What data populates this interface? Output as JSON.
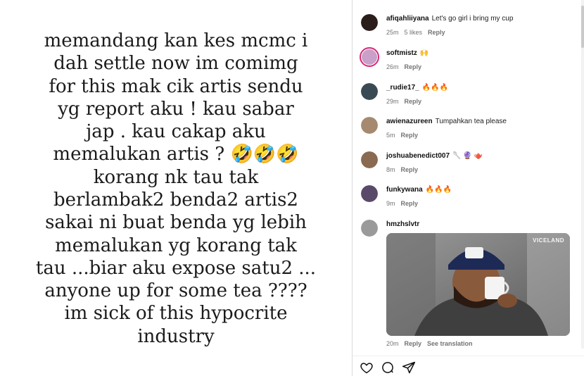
{
  "story": {
    "text": "memandang kan kes mcmc i\ndah settle now im comimg\nfor this mak cik artis sendu\nyg report aku ! kau sabar\njap . kau cakap aku\nmemalukan artis ? 🤣🤣🤣\nkorang nk tau tak\nberlambak2 benda2 artis2\nsakai ni buat benda yg lebih\nmemalukan yg korang tak\ntau ...biar aku expose satu2 ...\nanyone up for some tea ????\nim sick of this hypocrite\nindustry"
  },
  "comments": [
    {
      "username": "afiqahliiyana",
      "text": "Let's go girl i bring my cup",
      "time": "25m",
      "likes": "5 likes",
      "reply": "Reply",
      "avatar_color": "#2a1d1a"
    },
    {
      "username": "softmistz",
      "text": "🙌",
      "time": "26m",
      "reply": "Reply",
      "avatar_color": "#c8a0c8"
    },
    {
      "username": "_rudie17_",
      "text": "🔥🔥🔥",
      "time": "29m",
      "reply": "Reply",
      "avatar_color": "#3a4a55"
    },
    {
      "username": "awienazureen",
      "text": "Tumpahkan tea please",
      "time": "5m",
      "reply": "Reply",
      "avatar_color": "#a58a70"
    },
    {
      "username": "joshuabenedict007",
      "text": "🥄 🔮 🫖",
      "time": "8m",
      "reply": "Reply",
      "avatar_color": "#8a6a50"
    },
    {
      "username": "funkywana",
      "text": "🔥🔥🔥",
      "time": "9m",
      "reply": "Reply",
      "avatar_color": "#5a4a6a"
    },
    {
      "username": "hmzhslvtr",
      "text": "",
      "time": "20m",
      "reply": "Reply",
      "see_translation": "See translation",
      "avatar_color": "#9a9a9a"
    }
  ],
  "gif": {
    "label": "VICELAND"
  },
  "actions": {
    "like_icon": "heart-icon",
    "comment_icon": "comment-icon",
    "share_icon": "share-icon"
  }
}
